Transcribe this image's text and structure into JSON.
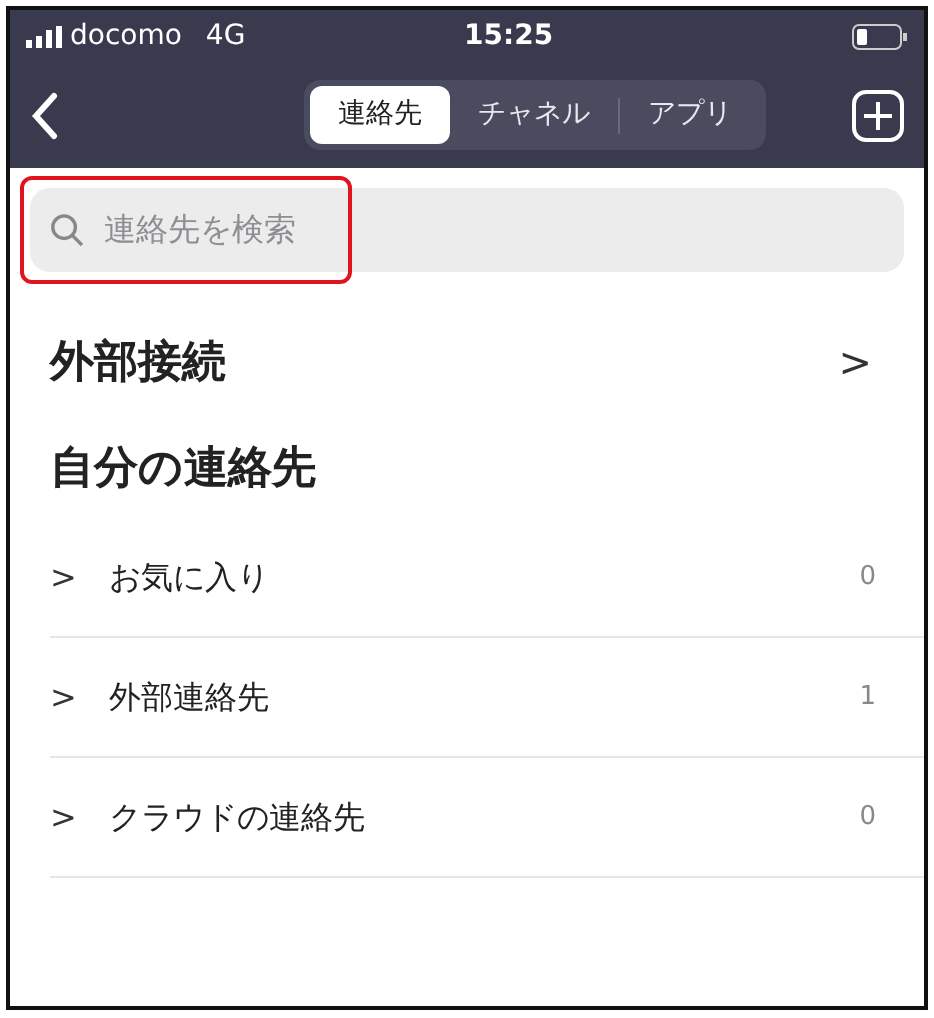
{
  "status_bar": {
    "carrier": "docomo",
    "network": "4G",
    "time": "15:25"
  },
  "nav": {
    "tabs": [
      {
        "label": "連絡先",
        "selected": true
      },
      {
        "label": "チャネル",
        "selected": false
      },
      {
        "label": "アプリ",
        "selected": false
      }
    ]
  },
  "search": {
    "placeholder": "連絡先を検索",
    "highlighted": true
  },
  "external": {
    "title": "外部接続",
    "chevron": ">"
  },
  "my_contacts": {
    "title": "自分の連絡先",
    "items": [
      {
        "label": "お気に入り",
        "count": "0",
        "chevron": ">"
      },
      {
        "label": "外部連絡先",
        "count": "1",
        "chevron": ">"
      },
      {
        "label": "クラウドの連絡先",
        "count": "0",
        "chevron": ">"
      }
    ]
  }
}
